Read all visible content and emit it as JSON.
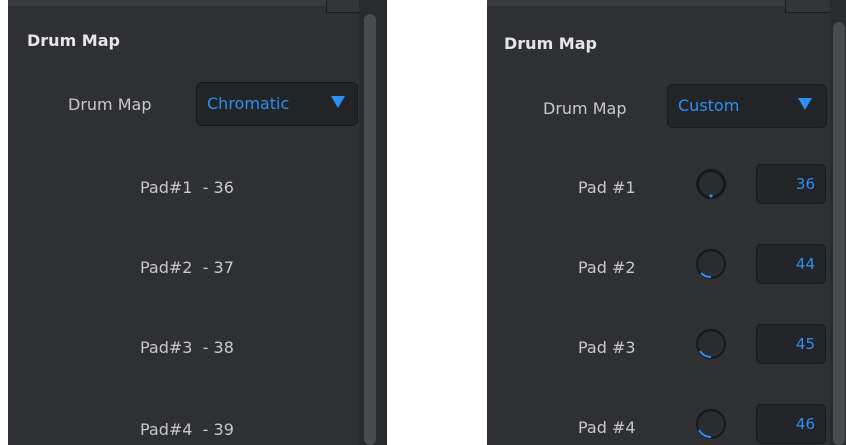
{
  "left_panel": {
    "section_title": "Drum Map",
    "drum_map_label": "Drum Map",
    "dropdown_value": "Chromatic",
    "pads": [
      {
        "text": "Pad#1  - 36"
      },
      {
        "text": "Pad#2  - 37"
      },
      {
        "text": "Pad#3  - 38"
      },
      {
        "text": "Pad#4  - 39"
      }
    ]
  },
  "right_panel": {
    "section_title": "Drum Map",
    "drum_map_label": "Drum Map",
    "dropdown_value": "Custom",
    "pads": [
      {
        "label": "Pad #1",
        "value": "36",
        "knob_level": 0.0
      },
      {
        "label": "Pad #2",
        "value": "44",
        "knob_level": 0.1
      },
      {
        "label": "Pad #3",
        "value": "45",
        "knob_level": 0.12
      },
      {
        "label": "Pad #4",
        "value": "46",
        "knob_level": 0.14
      }
    ]
  },
  "colors": {
    "panel_bg": "#2f3033",
    "accent_blue": "#2d8ff2",
    "text_light": "#c9c9c9"
  }
}
